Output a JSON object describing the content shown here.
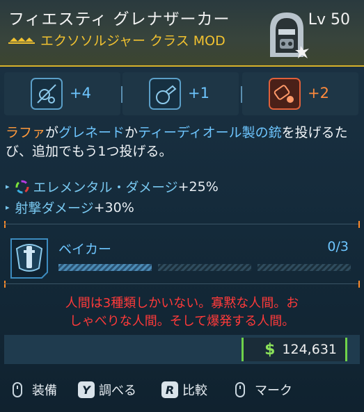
{
  "item": {
    "name": "フィエスティ グレナザーカー",
    "type_line": "エクソソルジャー クラス MOD",
    "level": "Lv 50"
  },
  "stats": [
    {
      "value": "+4",
      "color": "#6ec6ff",
      "icon": "grenade-skill-icon"
    },
    {
      "value": "+1",
      "color": "#6ec6ff",
      "icon": "grenade-launcher-icon"
    },
    {
      "value": "+2",
      "color": "#ff8a3c",
      "icon": "explosive-skill-icon"
    }
  ],
  "description": {
    "p1": "ラファ",
    "p2": "が",
    "p3": "グレネード",
    "p4": "か",
    "p5": "ティーディオール製の銃",
    "p6": "を投げるたび、追加でもう1つ投げる。"
  },
  "bonuses": [
    {
      "label": "エレメンタル・ダメージ",
      "value": "+25%"
    },
    {
      "label": "射撃ダメージ",
      "value": "+30%"
    }
  ],
  "skill": {
    "name": "ベイカー",
    "count": "0/3",
    "points": 0,
    "max": 3
  },
  "flavor": {
    "line1": "人間は3種類しかいない。寡黙な人間。お",
    "line2": "しゃべりな人間。そして爆発する人間。"
  },
  "price": {
    "symbol": "$",
    "amount": "124,631"
  },
  "controls": [
    {
      "key": "",
      "label": "装備",
      "kind": "mouse"
    },
    {
      "key": "Y",
      "label": "調べる",
      "kind": "key"
    },
    {
      "key": "R",
      "label": "比較",
      "kind": "key"
    },
    {
      "key": "",
      "label": "マーク",
      "kind": "mouse"
    }
  ]
}
